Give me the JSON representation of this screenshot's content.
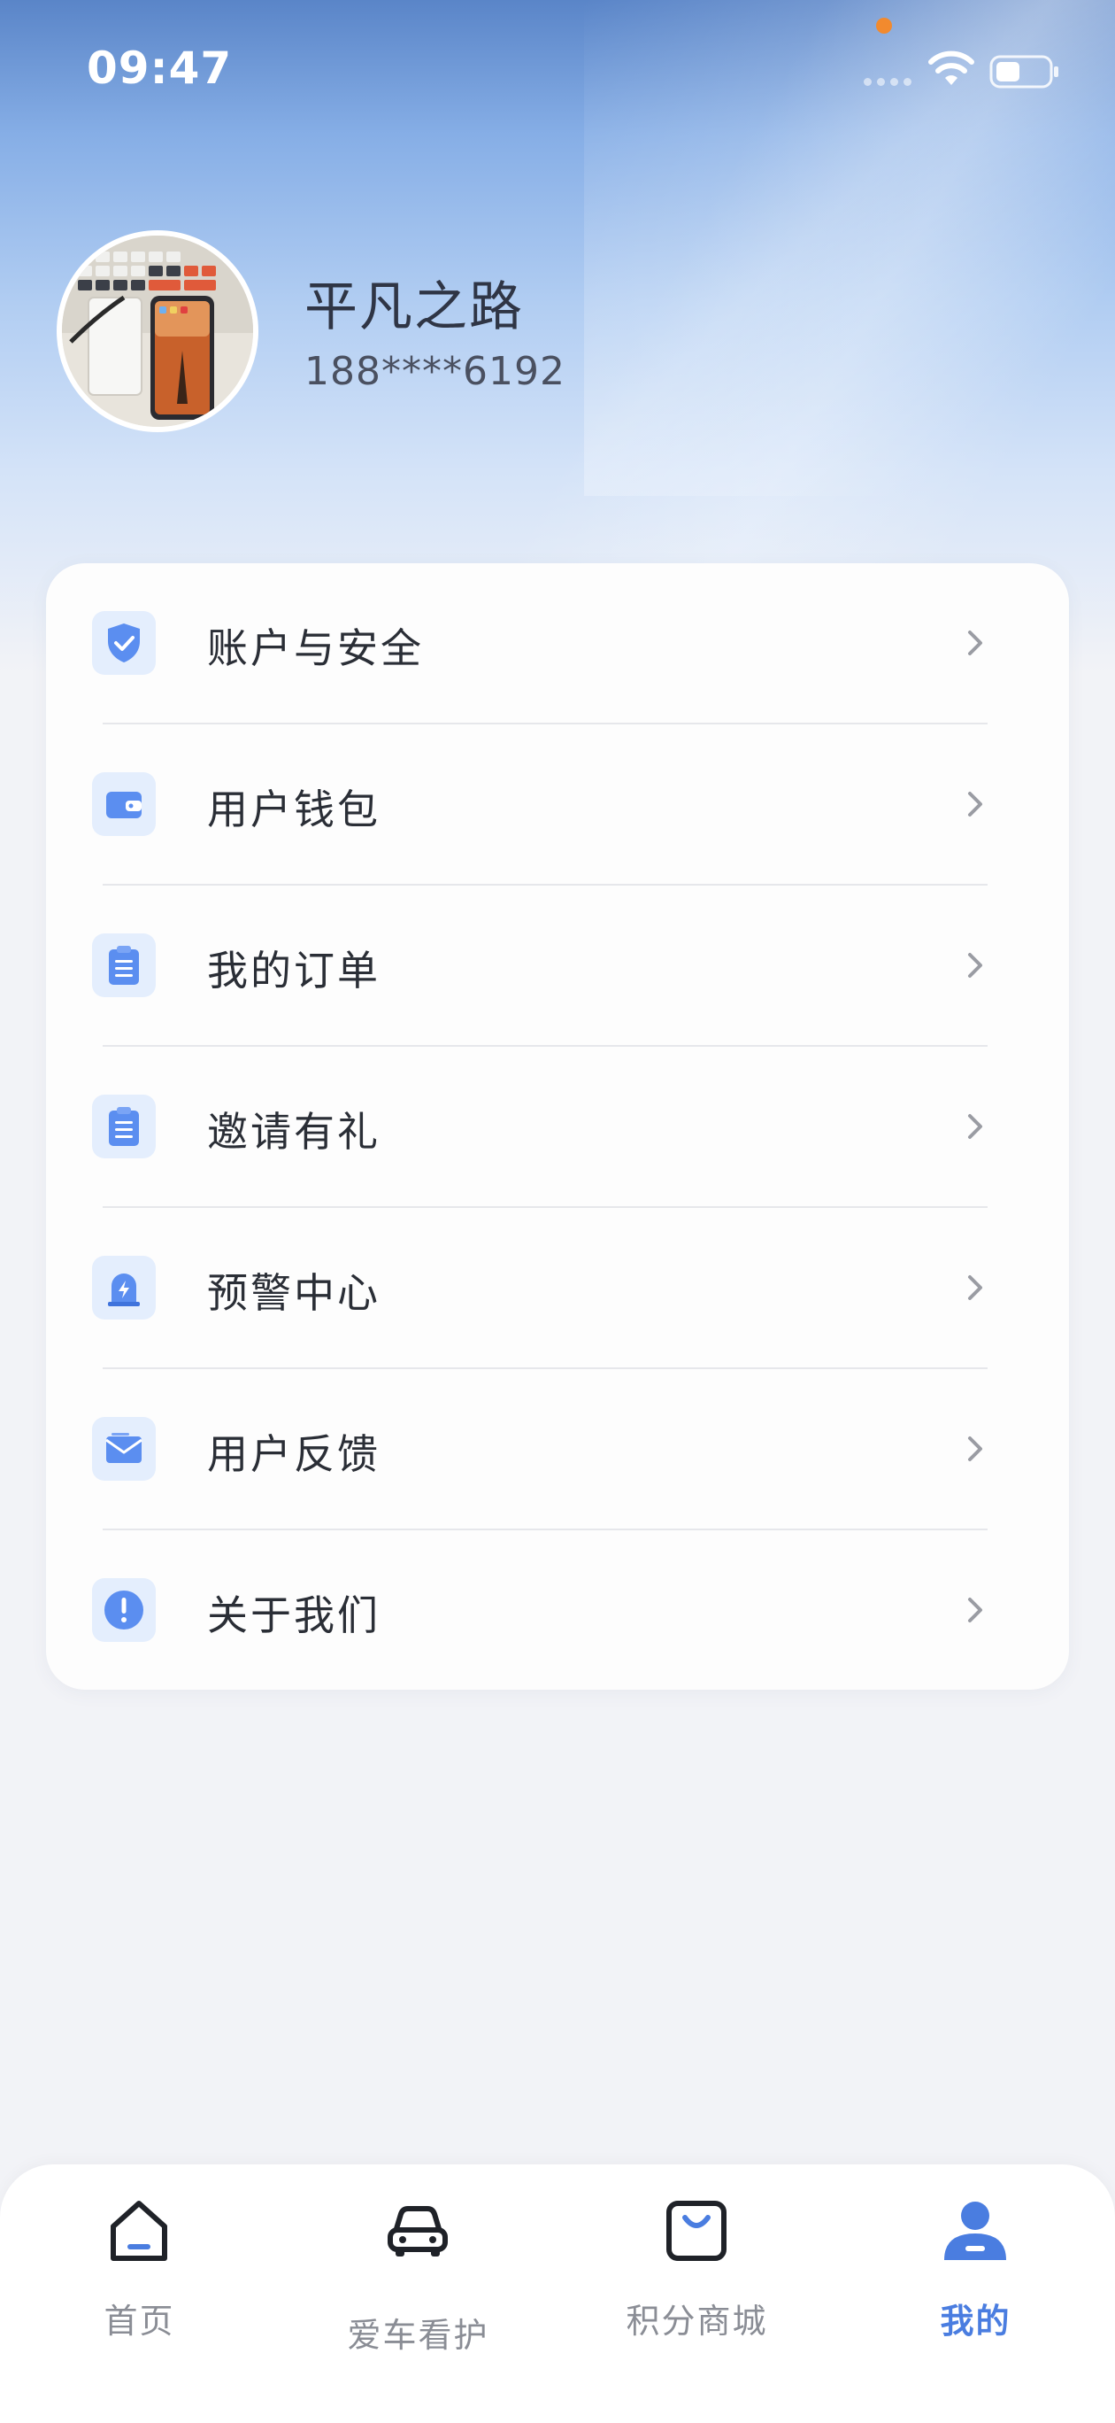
{
  "status_bar": {
    "time": "09:47"
  },
  "profile": {
    "name": "平凡之路",
    "phone": "188****6192"
  },
  "colors": {
    "accent": "#4a7de0",
    "icon_bg": "#e4eefd",
    "icon_fg": "#5b8ef0"
  },
  "menu": {
    "items": [
      {
        "label": "账户与安全",
        "icon": "shield-check-icon"
      },
      {
        "label": "用户钱包",
        "icon": "wallet-icon"
      },
      {
        "label": "我的订单",
        "icon": "clipboard-icon"
      },
      {
        "label": "邀请有礼",
        "icon": "clipboard-icon"
      },
      {
        "label": "预警中心",
        "icon": "alarm-icon"
      },
      {
        "label": "用户反馈",
        "icon": "mail-icon"
      },
      {
        "label": "关于我们",
        "icon": "info-icon"
      }
    ]
  },
  "tabbar": {
    "tabs": [
      {
        "label": "首页",
        "icon": "home-icon",
        "active": false
      },
      {
        "label": "爱车看护",
        "icon": "car-icon",
        "active": false
      },
      {
        "label": "积分商城",
        "icon": "shopping-bag-icon",
        "active": false
      },
      {
        "label": "我的",
        "icon": "user-icon",
        "active": true
      }
    ]
  }
}
